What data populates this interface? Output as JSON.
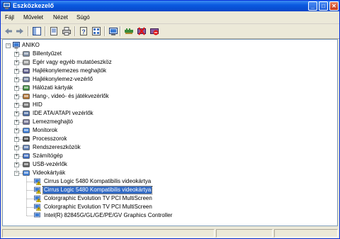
{
  "window": {
    "title": "Eszközkezelő",
    "min_glyph": "_",
    "max_glyph": "□",
    "close_glyph": "✕"
  },
  "menu": [
    "Fájl",
    "Művelet",
    "Nézet",
    "Súgó"
  ],
  "toolbar": [
    "back-icon",
    "forward-icon",
    "console-tree-icon",
    "properties-icon",
    "print-icon",
    "help-icon",
    "view-icon",
    "scan-hardware-icon",
    "update-driver-icon",
    "uninstall-icon",
    "disable-icon"
  ],
  "tree": {
    "root": "ANIKO",
    "categories": [
      {
        "label": "Billentyűzet",
        "icon": "keyboard-icon"
      },
      {
        "label": "Egér vagy egyéb mutatóeszköz",
        "icon": "mouse-icon"
      },
      {
        "label": "Hajlékonylemezes meghajtók",
        "icon": "floppy-drive-icon"
      },
      {
        "label": "Hajlékonylemez-vezérlő",
        "icon": "floppy-controller-icon"
      },
      {
        "label": "Hálózati kártyák",
        "icon": "network-card-icon"
      },
      {
        "label": "Hang-, videó- és játékvezérlők",
        "icon": "sound-icon"
      },
      {
        "label": "HID",
        "icon": "hid-icon"
      },
      {
        "label": "IDE ATA/ATAPI vezérlők",
        "icon": "ide-controller-icon"
      },
      {
        "label": "Lemezmeghajtó",
        "icon": "disk-drive-icon"
      },
      {
        "label": "Monitorok",
        "icon": "monitor-icon"
      },
      {
        "label": "Processzorok",
        "icon": "processor-icon"
      },
      {
        "label": "Rendszereszközök",
        "icon": "system-device-icon"
      },
      {
        "label": "Számítógép",
        "icon": "computer-icon"
      },
      {
        "label": "USB-vezérlők",
        "icon": "usb-icon"
      },
      {
        "label": "Videokártyák",
        "icon": "display-adapter-icon",
        "expanded": true
      }
    ],
    "video_devices": [
      {
        "label": "Cirrus Logic 5480 Kompatibilis videokártya",
        "warning": true,
        "selected": false
      },
      {
        "label": "Cirrus Logic 5480 Kompatibilis videokártya",
        "warning": true,
        "selected": true
      },
      {
        "label": "Colorgraphic Evolution TV PCI MultiScreen",
        "warning": true,
        "selected": false
      },
      {
        "label": "Colorgraphic Evolution TV PCI MultiScreen",
        "warning": true,
        "selected": false
      },
      {
        "label": "Intel(R) 82845G/GL/GE/PE/GV Graphics Controller",
        "warning": false,
        "selected": false
      }
    ]
  },
  "colors": {
    "title_blue": "#0a5ae0",
    "selection": "#316ac5",
    "warning": "#f5d800"
  }
}
